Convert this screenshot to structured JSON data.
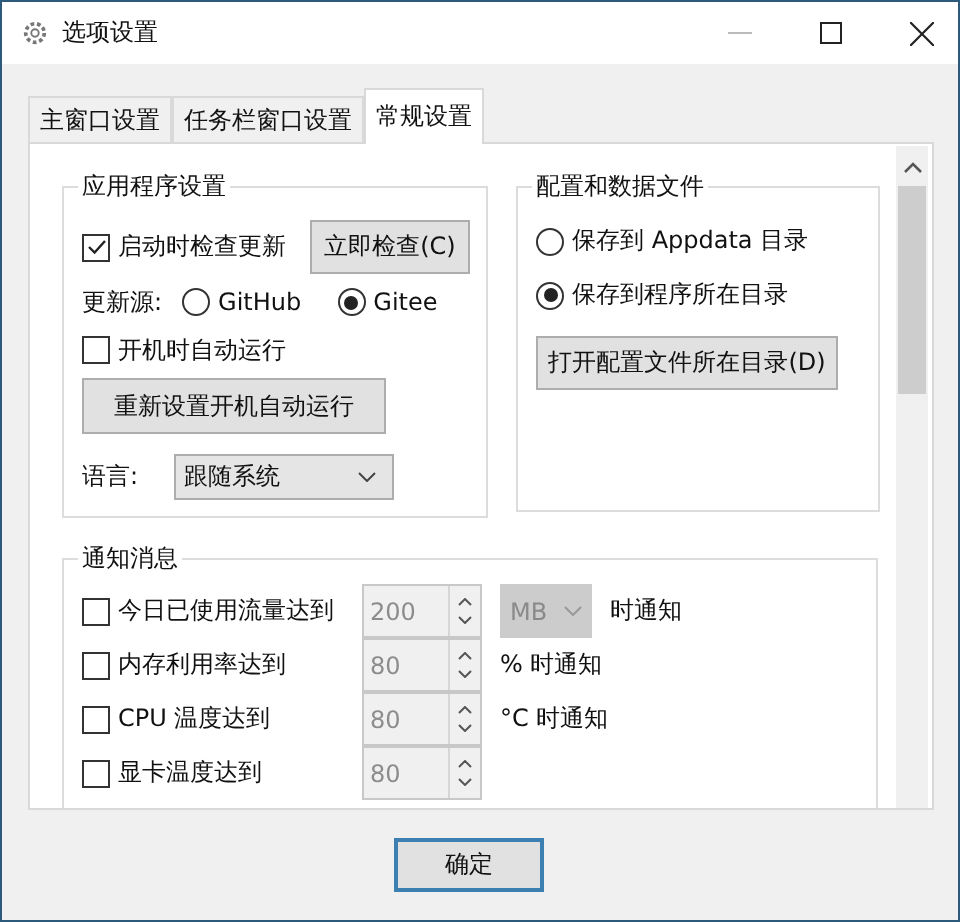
{
  "window": {
    "title": "选项设置"
  },
  "tabs": [
    {
      "label": "主窗口设置",
      "selected": false
    },
    {
      "label": "任务栏窗口设置",
      "selected": false
    },
    {
      "label": "常规设置",
      "selected": true
    }
  ],
  "app_settings": {
    "title": "应用程序设置",
    "check_update": {
      "label": "启动时检查更新",
      "checked": true
    },
    "check_now_button": "立即检查(C)",
    "update_source": {
      "label": "更新源:",
      "options": [
        {
          "label": "GitHub",
          "selected": false
        },
        {
          "label": "Gitee",
          "selected": true
        }
      ]
    },
    "autostart": {
      "label": "开机时自动运行",
      "checked": false
    },
    "reset_autostart_button": "重新设置开机自动运行",
    "language": {
      "label": "语言:",
      "value": "跟随系统"
    }
  },
  "config_files": {
    "title": "配置和数据文件",
    "options": [
      {
        "label": "保存到 Appdata 目录",
        "selected": false
      },
      {
        "label": "保存到程序所在目录",
        "selected": true
      }
    ],
    "open_button": "打开配置文件所在目录(D)"
  },
  "notifications": {
    "title": "通知消息",
    "rows": [
      {
        "label": "今日已使用流量达到",
        "checked": false,
        "value": "200",
        "disabled": true,
        "unit": "MB",
        "suffix": "时通知"
      },
      {
        "label": "内存利用率达到",
        "checked": false,
        "value": "80",
        "disabled": true,
        "suffix": "% 时通知"
      },
      {
        "label": "CPU 温度达到",
        "checked": false,
        "value": "80",
        "disabled": true,
        "suffix": "°C 时通知"
      },
      {
        "label": "显卡温度达到",
        "checked": false,
        "value": "80",
        "disabled": true
      }
    ]
  },
  "ok_button": "确定"
}
